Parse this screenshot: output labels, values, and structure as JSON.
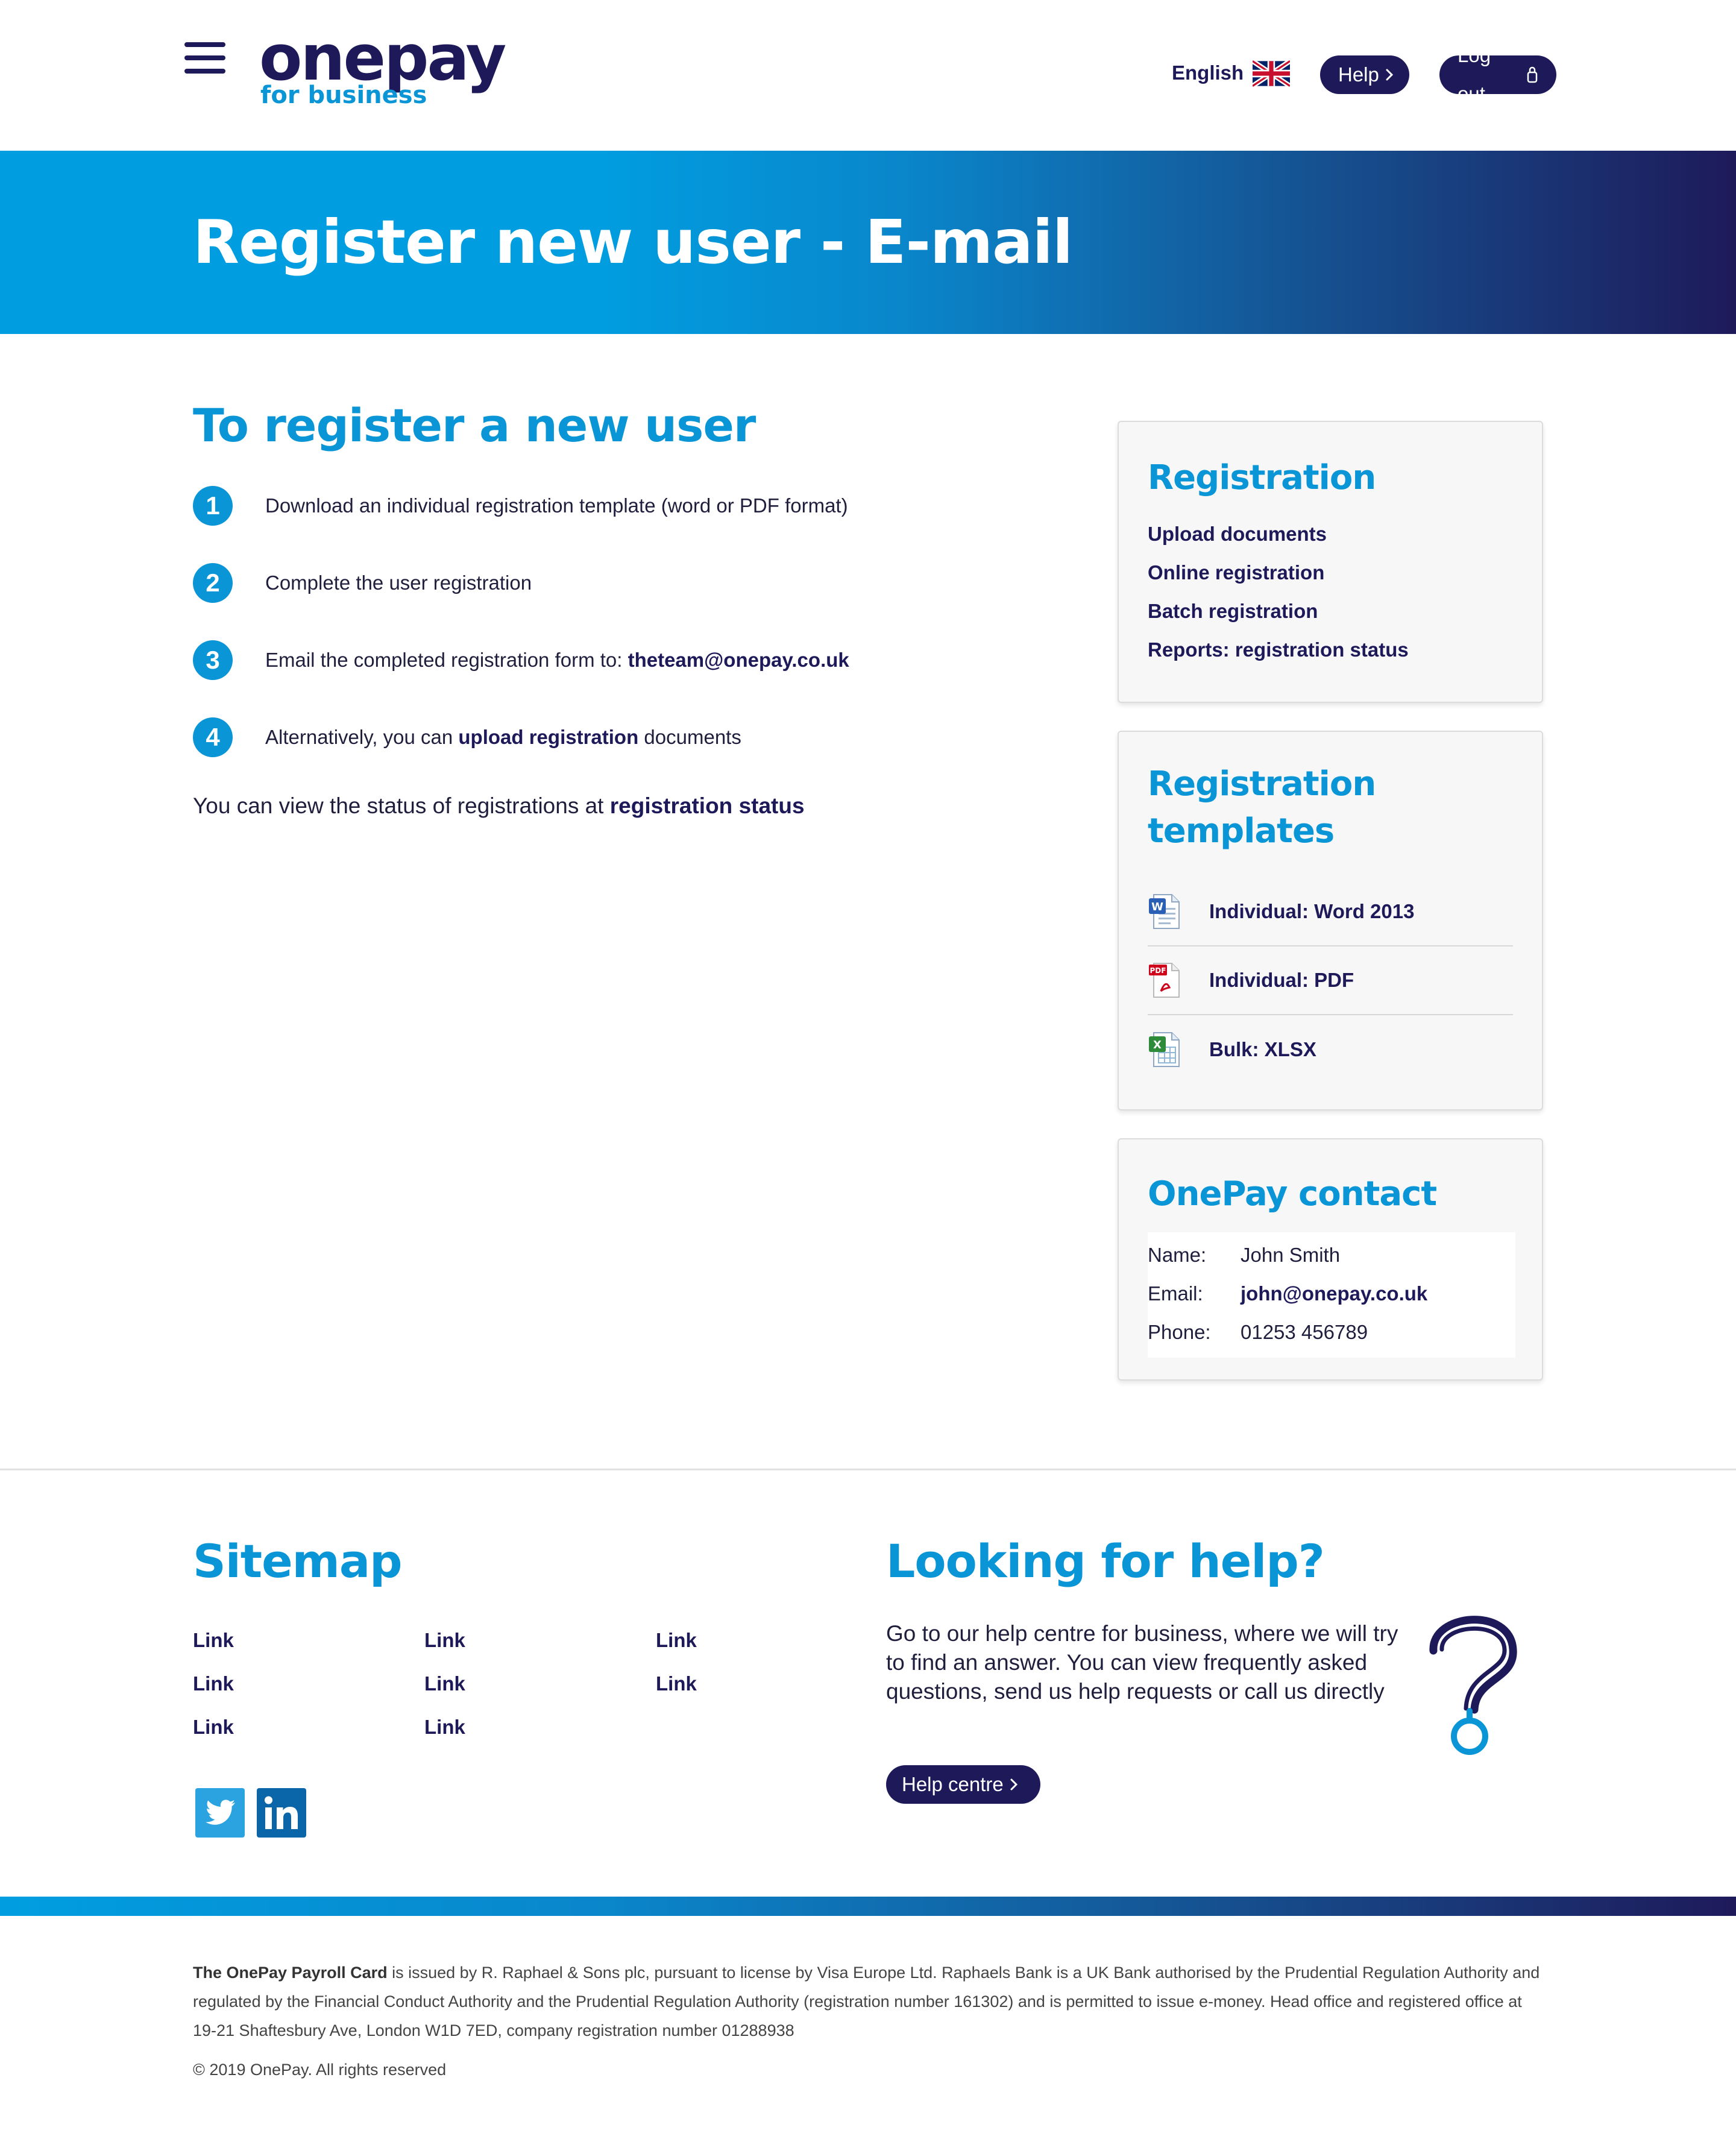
{
  "header": {
    "logo_word": "onepay",
    "logo_sub": "for business",
    "language": "English",
    "help_label": "Help",
    "logout_label": "Log out"
  },
  "banner": {
    "title": "Register new user - E-mail"
  },
  "main": {
    "title": "To register a new user",
    "steps": [
      {
        "num": "1",
        "text": "Download an individual registration template (word or PDF format)"
      },
      {
        "num": "2",
        "text": "Complete the user registration"
      },
      {
        "num": "3",
        "text_before": "Email the completed registration form to: ",
        "link": "theteam@onepay.co.uk"
      },
      {
        "num": "4",
        "text_before": "Alternatively, you can ",
        "link": "upload registration",
        "text_after": " documents"
      }
    ],
    "status_before": "You can view the status of registrations at ",
    "status_link": "registration status"
  },
  "sidebar": {
    "registration": {
      "title": "Registration",
      "links": [
        "Upload documents",
        "Online registration",
        "Batch registration",
        "Reports: registration status"
      ]
    },
    "templates": {
      "title_line1": "Registration",
      "title_line2": "templates",
      "items": [
        {
          "label": "Individual: Word 2013",
          "icon": "word-doc-icon"
        },
        {
          "label": "Individual: PDF",
          "icon": "pdf-doc-icon"
        },
        {
          "label": "Bulk: XLSX",
          "icon": "excel-doc-icon"
        }
      ]
    },
    "contact": {
      "title": "OnePay contact",
      "name_label": "Name:",
      "name": "John Smith",
      "email_label": "Email:",
      "email": "john@onepay.co.uk",
      "phone_label": "Phone:",
      "phone": "01253 456789"
    }
  },
  "footer": {
    "sitemap_title": "Sitemap",
    "sitemap_links": [
      "Link",
      "Link",
      "Link",
      "Link",
      "Link",
      "Link",
      "Link",
      "Link"
    ],
    "help_title": "Looking for help?",
    "help_text": "Go to our help centre for business, where we will try to find an answer. You can view frequently asked questions, send us help requests or call us directly",
    "help_centre_label": "Help centre",
    "legal_bold": "The OnePay Payroll Card",
    "legal_text": " is issued by R. Raphael & Sons plc, pursuant to license by Visa Europe Ltd. Raphaels Bank is a UK Bank authorised by the Prudential Regulation Authority and regulated by the Financial Conduct Authority and the Prudential Regulation Authority (registration number 161302) and is permitted to issue e-money. Head office and registered office at 19-21 Shaftesbury Ave, London W1D 7ED, company registration number 01288938",
    "copyright": "© 2019 OnePay. All rights reserved"
  },
  "colors": {
    "brand_navy": "#1e1a5a",
    "brand_blue": "#0a96d6",
    "banner_start": "#009ee0",
    "banner_end": "#1e1a5a"
  }
}
